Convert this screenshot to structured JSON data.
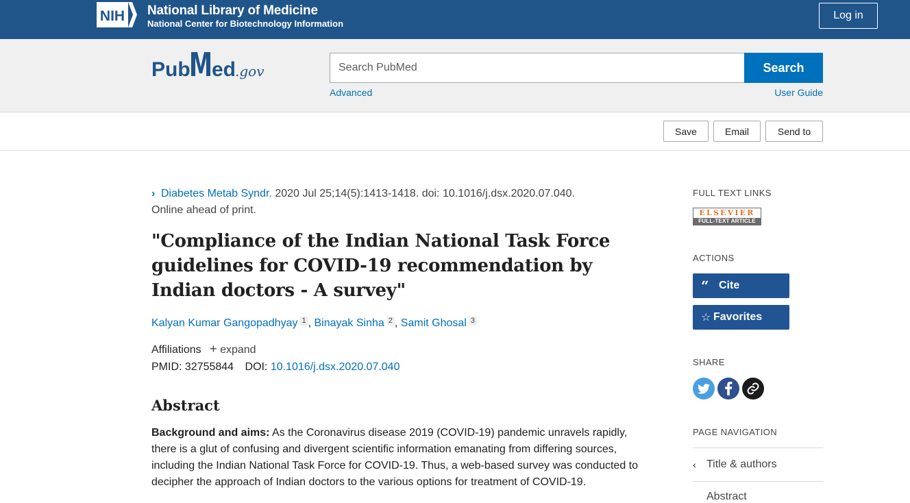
{
  "nih_banner": {
    "logo_text": "NIH",
    "title": "National Library of Medicine",
    "subtitle": "National Center for Biotechnology Information",
    "login_label": "Log in"
  },
  "search": {
    "logo_text": "PubMed.gov",
    "placeholder": "Search PubMed",
    "button_label": "Search",
    "advanced_label": "Advanced",
    "user_guide_label": "User Guide"
  },
  "toolbar": {
    "save_label": "Save",
    "email_label": "Email",
    "send_to_label": "Send to"
  },
  "article": {
    "journal": "Diabetes Metab Syndr.",
    "citation_rest": " 2020 Jul 25;14(5):1413-1418. doi: 10.1016/j.dsx.2020.07.040.",
    "citation_line2": "Online ahead of print.",
    "title": "\"Compliance of the Indian National Task Force guidelines for COVID-19 recommendation by Indian doctors - A survey\"",
    "authors": [
      {
        "name": "Kalyan Kumar Gangopadhyay",
        "aff": "1"
      },
      {
        "name": "Binayak Sinha",
        "aff": "2"
      },
      {
        "name": "Samit Ghosal",
        "aff": "3"
      }
    ],
    "affiliations_label": "Affiliations",
    "expand_label": "expand",
    "pmid_label": "PMID: 32755844",
    "doi_label": "DOI:",
    "doi_value": "10.1016/j.dsx.2020.07.040",
    "abstract_heading": "Abstract",
    "abstract_label": "Background and aims:",
    "abstract_text": " As the Coronavirus disease 2019 (COVID-19) pandemic unravels rapidly, there is a glut of confusing and divergent scientific information emanating from differing sources, including the Indian National Task Force for COVID-19. Thus, a web-based survey was conducted to decipher the approach of Indian doctors to the various options for treatment of COVID-19."
  },
  "sidebar": {
    "full_text_heading": "Full text links",
    "elsevier_top": "ELSEVIER",
    "elsevier_bottom": "FULL-TEXT ARTICLE",
    "actions_heading": "Actions",
    "cite_label": "Cite",
    "favorites_label": "Favorites",
    "share_heading": "Share",
    "page_nav_heading": "Page navigation",
    "nav_items": [
      "Title & authors",
      "Abstract"
    ]
  },
  "colors": {
    "nih_blue": "#20558a",
    "link_blue": "#0071bc",
    "action_blue": "#205493",
    "twitter": "#4a9fe0",
    "facebook": "#2f4f8f"
  }
}
